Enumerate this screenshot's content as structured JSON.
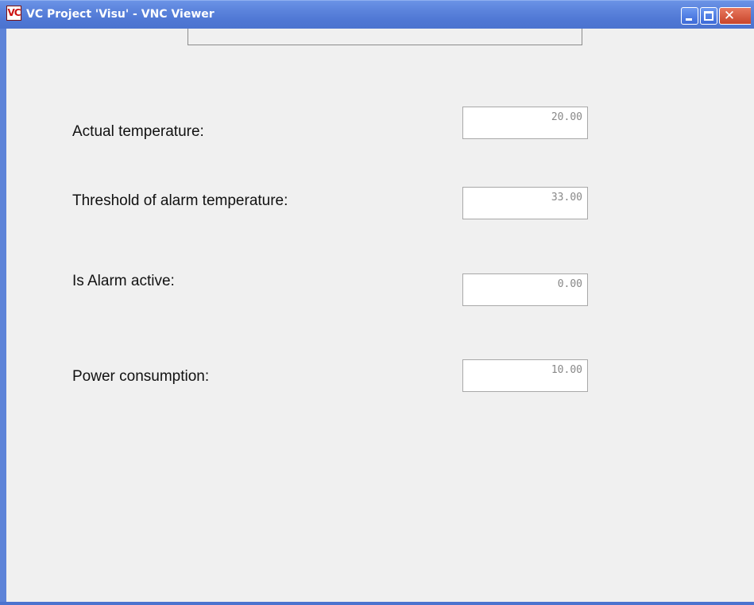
{
  "window": {
    "title": "VC Project 'Visu' - VNC Viewer",
    "app_icon_text": "VC",
    "controls": {
      "minimize": "minimize-icon",
      "maximize": "maximize-icon",
      "close": "close-icon"
    },
    "colors": {
      "titlebar": "#4f77d4",
      "close_button": "#c8452b",
      "client_background": "#f0f0f0"
    }
  },
  "form": {
    "fields": [
      {
        "label": "Actual temperature:",
        "value": "20.00"
      },
      {
        "label": "Threshold of alarm temperature:",
        "value": "33.00"
      },
      {
        "label": "Is Alarm active:",
        "value": "0.00"
      },
      {
        "label": "Power consumption:",
        "value": "10.00"
      }
    ]
  }
}
